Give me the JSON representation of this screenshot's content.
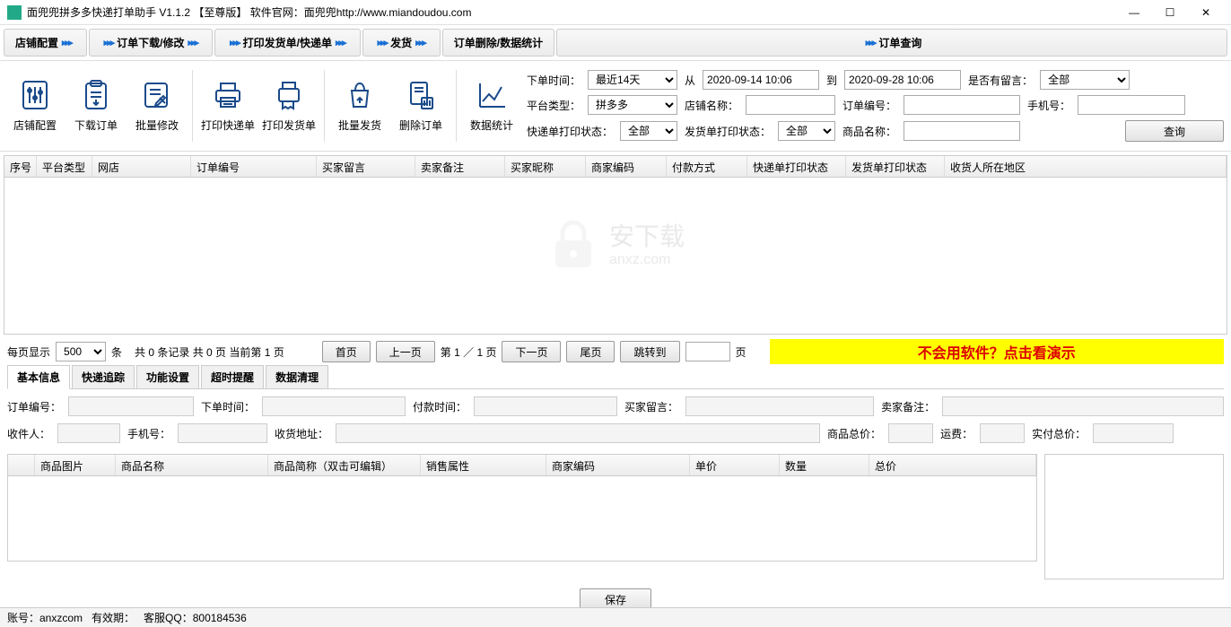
{
  "title": "面兜兜拼多多快递打单助手 V1.1.2 【至尊版】    软件官网：面兜兜http://www.miandoudou.com",
  "steps": {
    "s1": "店铺配置",
    "s2": "订单下载/修改",
    "s3": "打印发货单/快递单",
    "s4": "发货",
    "s5": "订单删除/数据统计",
    "s6": "订单查询"
  },
  "tools": {
    "t1": "店铺配置",
    "t2": "下载订单",
    "t3": "批量修改",
    "t4": "打印快递单",
    "t5": "打印发货单",
    "t6": "批量发货",
    "t7": "删除订单",
    "t8": "数据统计"
  },
  "filters": {
    "order_time_lbl": "下单时间：",
    "order_time_val": "最近14天",
    "from_lbl": "从",
    "from_val": "2020-09-14 10:06",
    "to_lbl": "到",
    "to_val": "2020-09-28 10:06",
    "has_msg_lbl": "是否有留言：",
    "has_msg_val": "全部",
    "platform_lbl": "平台类型：",
    "platform_val": "拼多多",
    "shop_name_lbl": "店铺名称：",
    "order_no_lbl": "订单编号：",
    "phone_lbl": "手机号：",
    "express_print_lbl": "快递单打印状态：",
    "express_print_val": "全部",
    "ship_print_lbl": "发货单打印状态：",
    "ship_print_val": "全部",
    "goods_name_lbl": "商品名称：",
    "query_btn": "查询"
  },
  "table_cols": {
    "c1": "序号",
    "c2": "平台类型",
    "c3": "网店",
    "c4": "订单编号",
    "c5": "买家留言",
    "c6": "卖家备注",
    "c7": "买家昵称",
    "c8": "商家编码",
    "c9": "付款方式",
    "c10": "快递单打印状态",
    "c11": "发货单打印状态",
    "c12": "收货人所在地区"
  },
  "watermark": {
    "main": "安下载",
    "sub": "anxz.com"
  },
  "pager": {
    "per_page_lbl": "每页显示",
    "per_page_val": "500",
    "unit": "条",
    "total": "共  0  条记录    共  0  页      当前第  1  页",
    "first": "首页",
    "prev": "上一页",
    "page_info": "第 1 ／ 1  页",
    "next": "下一页",
    "last": "尾页",
    "jump": "跳转到",
    "jump_unit": "页",
    "demo": "不会用软件？点击看演示"
  },
  "detail_tabs": {
    "t1": "基本信息",
    "t2": "快递追踪",
    "t3": "功能设置",
    "t4": "超时提醒",
    "t5": "数据清理"
  },
  "detail": {
    "order_no": "订单编号：",
    "order_time": "下单时间：",
    "pay_time": "付款时间：",
    "buyer_msg": "买家留言：",
    "seller_note": "卖家备注：",
    "receiver": "收件人：",
    "phone": "手机号：",
    "address": "收货地址：",
    "goods_total": "商品总价：",
    "ship_fee": "运费：",
    "pay_total": "实付总价："
  },
  "sub_cols": {
    "c1": "商品图片",
    "c2": "商品名称",
    "c3": "商品简称（双击可编辑）",
    "c4": "销售属性",
    "c5": "商家编码",
    "c6": "单价",
    "c7": "数量",
    "c8": "总价"
  },
  "save_btn": "保存",
  "status": {
    "account": "账号：anxzcom",
    "expire": "有效期：",
    "qq": "客服QQ：800184536"
  }
}
